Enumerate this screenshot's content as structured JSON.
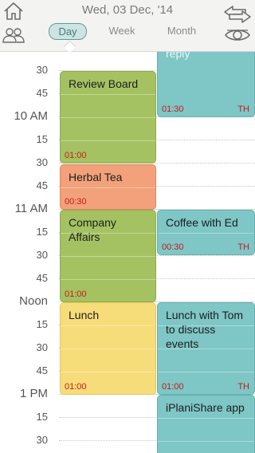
{
  "header": {
    "date": "Wed, 03 Dec, '14",
    "tabs": [
      {
        "label": "Day",
        "active": true
      },
      {
        "label": "Week",
        "active": false
      },
      {
        "label": "Month",
        "active": false
      }
    ],
    "icons": [
      "home-icon",
      "people-icon",
      "swap-arrows-icon",
      "eye-icon"
    ]
  },
  "time_labels": {
    "t0": "30",
    "t1": "45",
    "t2": "10 AM",
    "t3": "15",
    "t4": "30",
    "t5": "45",
    "t6": "11 AM",
    "t7": "15",
    "t8": "30",
    "t9": "45",
    "t10": "Noon",
    "t11": "15",
    "t12": "30",
    "t13": "45",
    "t14": "1 PM",
    "t15": "15",
    "t16": "30"
  },
  "events": {
    "reply": {
      "title": "reply",
      "duration": "01:30",
      "flag": "TH",
      "color": "#7fc6c6"
    },
    "review_board": {
      "title": "Review Board",
      "duration": "01:00",
      "color": "#a5c263"
    },
    "herbal_tea": {
      "title": "Herbal Tea",
      "duration": "00:30",
      "color": "#f3a17a"
    },
    "company_affairs": {
      "title": "Company Affairs",
      "duration": "01:00",
      "color": "#a5c263"
    },
    "coffee_ed": {
      "title": "Coffee with Ed",
      "duration": "00:30",
      "flag": "TH",
      "color": "#7fc6c6"
    },
    "lunch": {
      "title": "Lunch",
      "duration": "01:00",
      "color": "#f7dc7a"
    },
    "lunch_tom": {
      "title": "Lunch with Tom to discuss events",
      "duration": "01:00",
      "flag": "TH",
      "color": "#7fc6c6"
    },
    "iplanishare": {
      "title": "iPlaniShare app",
      "color": "#7fc6c6"
    }
  }
}
